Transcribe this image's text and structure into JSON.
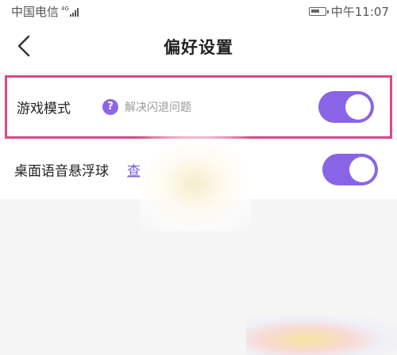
{
  "status_bar": {
    "carrier": "中国电信",
    "network": "4G",
    "time": "中午11:07"
  },
  "header": {
    "title": "偏好设置",
    "back_icon": "chevron-left-icon"
  },
  "settings": [
    {
      "label": "游戏模式",
      "help_icon": "question-icon",
      "help_text": "解决闪退问题",
      "enabled": true
    },
    {
      "label": "桌面语音悬浮球",
      "link_text": "查",
      "enabled": true
    }
  ],
  "colors": {
    "accent": "#8a64e6",
    "highlight_border": "#d94a8a"
  }
}
